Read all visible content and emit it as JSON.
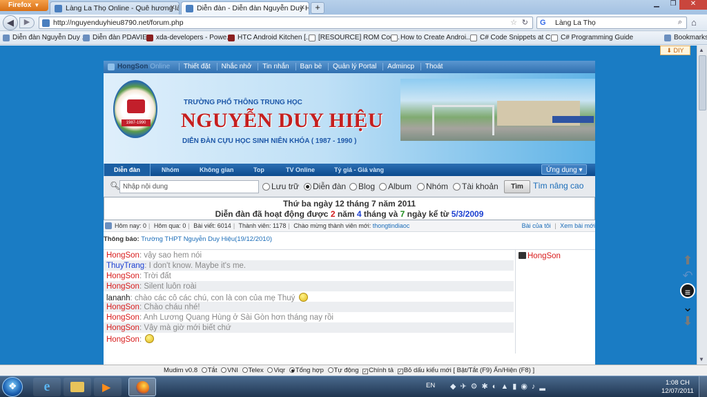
{
  "browser": {
    "menu_button": "Firefox",
    "tabs": [
      {
        "title": "Làng La Thọ Online - Quê hương là c...",
        "active": false
      },
      {
        "title": "Diễn đàn - Diễn đàn Nguyễn Duy Hiệ...",
        "active": true
      }
    ],
    "new_tab": "+",
    "url": "http://nguyenduyhieu8790.net/forum.php",
    "search_engine": "G",
    "search_query": "Làng La Thọ",
    "bookmarks": [
      "Diễn đàn Nguyễn Duy ...",
      "Diễn đàn PDAVIET",
      "xda-developers - Powe...",
      "HTC Android Kitchen [...",
      "[RESOURCE] ROM Coo...",
      "How to Create Androi...",
      "C# Code Snippets at C...",
      "C# Programming Guide"
    ],
    "bookmarks_menu": "Bookmarks",
    "diy_label": "DIY"
  },
  "forum": {
    "top_menu": {
      "username": "HongSon",
      "online_label": "Online",
      "items": [
        "Thiết đặt",
        "Nhắc nhở",
        "Tin nhắn",
        "Bạn bè",
        "Quản lý Portal",
        "Admincp",
        "Thoát"
      ]
    },
    "banner": {
      "subtitle": "TRƯỜNG PHỔ THÔNG TRUNG HỌC",
      "school_name": "NGUYỄN DUY HIỆU",
      "description": "DIỄN ĐÀN CỰU HỌC SINH NIÊN KHÓA ( 1987 - 1990 )",
      "seal_years": "1987-1990"
    },
    "main_nav": {
      "items": [
        "Diễn đàn",
        "Nhóm",
        "Không gian",
        "Top",
        "TV Online",
        "Tỷ giá - Giá vàng"
      ],
      "dropdown": "Ứng dụng"
    },
    "search": {
      "placeholder": "Nhập nội dung",
      "options": [
        "Lưu trữ",
        "Diễn đàn",
        "Blog",
        "Album",
        "Nhóm",
        "Tài khoản"
      ],
      "selected": "Diễn đàn",
      "button": "Tìm",
      "advanced": "Tìm nâng cao"
    },
    "date": {
      "line1": "Thứ ba ngày 12 tháng 7 năm 2011",
      "line2_prefix": "Diễn đàn đã hoạt động được",
      "years": "2",
      "years_label": "năm",
      "months": "4",
      "months_label": "tháng và",
      "days": "7",
      "days_label": "ngày kể từ",
      "since": "5/3/2009"
    },
    "stats": {
      "today": "Hôm nay: 0",
      "yesterday": "Hôm qua: 0",
      "posts": "Bài viết: 6014",
      "members": "Thành viên: 1178",
      "welcome": "Chào mừng thành viên mới:",
      "newest_member": "thongtindiaoc",
      "my_posts": "Bài của tôi",
      "new_posts": "Xem bài mới"
    },
    "notice": {
      "label": "Thông báo:",
      "text": "Trường THPT Nguyễn Duy Hiệu(19/12/2010)"
    },
    "chat": [
      {
        "user": "HongSon",
        "color": "red",
        "text": "vậy sao hem nói",
        "smiley": false
      },
      {
        "user": "ThuyTrang",
        "color": "blue",
        "text": "I don't know. Maybe it's me.",
        "smiley": false
      },
      {
        "user": "HongSon",
        "color": "red",
        "text": "Trời đất",
        "smiley": false
      },
      {
        "user": "HongSon",
        "color": "red",
        "text": "Silent luôn roài",
        "smiley": false
      },
      {
        "user": "lananh",
        "color": "black",
        "text": "chào các cô các chú, con là con của mẹ Thuý",
        "smiley": true
      },
      {
        "user": "HongSon",
        "color": "red",
        "text": "Chào cháu nhé!",
        "smiley": false
      },
      {
        "user": "HongSon",
        "color": "red",
        "text": "Anh Lương Quang Hùng ở Sài Gòn hơn tháng nay rồi",
        "smiley": false
      },
      {
        "user": "HongSon",
        "color": "red",
        "text": "Vậy mà giờ mới biết chứ",
        "smiley": false
      },
      {
        "user": "HongSon",
        "color": "red",
        "text": "",
        "smiley": true
      }
    ],
    "online_users": [
      "HongSon"
    ]
  },
  "mudim": {
    "name": "Mudim v0.8",
    "modes": [
      "Tắt",
      "VNI",
      "Telex",
      "Viqr",
      "Tổng hợp",
      "Tự động"
    ],
    "selected_mode": "Tổng hợp",
    "checks": [
      "Chính tả",
      "Bỏ dấu kiểu mới"
    ],
    "hotkeys": "[ Bật/Tắt (F9) Ẩn/Hiện (F8) ]"
  },
  "taskbar": {
    "language": "EN",
    "time": "1:08 CH",
    "date": "12/07/2011"
  }
}
